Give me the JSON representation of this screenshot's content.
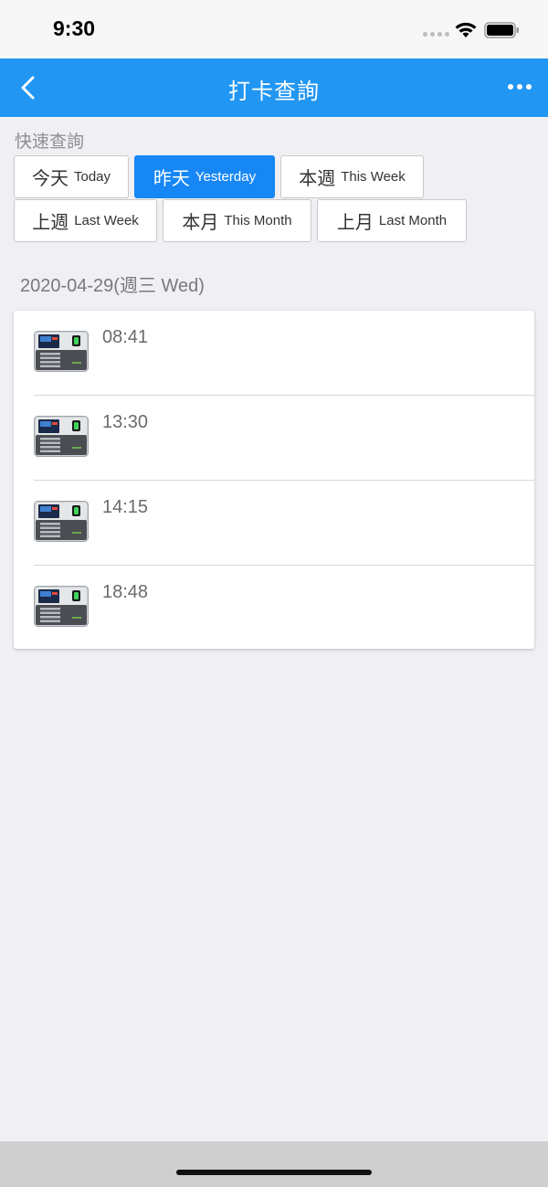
{
  "status_bar": {
    "time": "9:30"
  },
  "nav": {
    "title": "打卡查詢"
  },
  "quick_query": {
    "label": "快速查詢",
    "buttons": [
      {
        "zh": "今天",
        "en": "Today",
        "active": false
      },
      {
        "zh": "昨天",
        "en": "Yesterday",
        "active": true
      },
      {
        "zh": "本週",
        "en": "This Week",
        "active": false
      },
      {
        "zh": "上週",
        "en": "Last Week",
        "active": false
      },
      {
        "zh": "本月",
        "en": "This Month",
        "active": false
      },
      {
        "zh": "上月",
        "en": "Last Month",
        "active": false
      }
    ]
  },
  "records": {
    "date": "2020-04-29(週三 Wed)",
    "punches": [
      {
        "time": "08:41",
        "icon": "time-clock-device-icon"
      },
      {
        "time": "13:30",
        "icon": "time-clock-device-icon"
      },
      {
        "time": "14:15",
        "icon": "time-clock-device-icon"
      },
      {
        "time": "18:48",
        "icon": "time-clock-device-icon"
      }
    ]
  },
  "colors": {
    "nav_bar": "#2196f3",
    "active_button": "#1787f5",
    "background": "#efeff4"
  }
}
